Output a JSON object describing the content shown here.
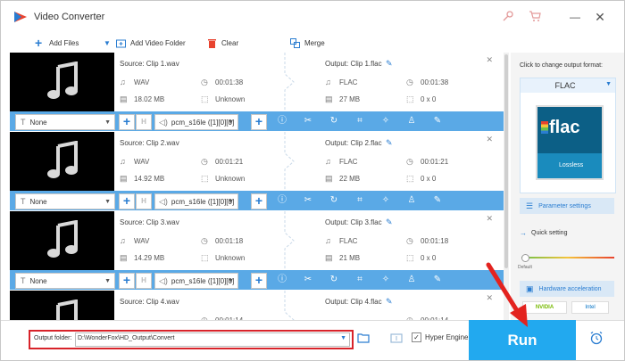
{
  "window": {
    "title": "Video Converter",
    "brand_color": "#2a7dd1",
    "accent_color": "#22a9ef",
    "icons": [
      "key-icon",
      "cart-icon",
      "minimize-icon",
      "close-icon"
    ]
  },
  "toolbar": {
    "add_files": "Add Files",
    "add_video_folder": "Add Video Folder",
    "clear": "Clear",
    "merge": "Merge"
  },
  "clips": [
    {
      "source": "Source: Clip 1.wav",
      "src_format": "WAV",
      "src_duration": "00:01:38",
      "src_size": "18.02 MB",
      "src_res": "Unknown",
      "output": "Output: Clip 1.flac",
      "out_format": "FLAC",
      "out_duration": "00:01:38",
      "out_size": "27 MB",
      "out_res": "0 x 0",
      "subtitle": "None",
      "audio": "pcm_s16le ([1][0][0]"
    },
    {
      "source": "Source: Clip 2.wav",
      "src_format": "WAV",
      "src_duration": "00:01:21",
      "src_size": "14.92 MB",
      "src_res": "Unknown",
      "output": "Output: Clip 2.flac",
      "out_format": "FLAC",
      "out_duration": "00:01:21",
      "out_size": "22 MB",
      "out_res": "0 x 0",
      "subtitle": "None",
      "audio": "pcm_s16le ([1][0][0]"
    },
    {
      "source": "Source: Clip 3.wav",
      "src_format": "WAV",
      "src_duration": "00:01:18",
      "src_size": "14.29 MB",
      "src_res": "Unknown",
      "output": "Output: Clip 3.flac",
      "out_format": "FLAC",
      "out_duration": "00:01:18",
      "out_size": "21 MB",
      "out_res": "0 x 0",
      "subtitle": "None",
      "audio": "pcm_s16le ([1][0][0]"
    },
    {
      "source": "Source: Clip 4.wav",
      "src_duration": "00:01:14",
      "output": "Output: Clip 4.flac",
      "out_duration": "00:01:14"
    }
  ],
  "right_panel": {
    "hint": "Click to change output format:",
    "format": "FLAC",
    "format_icon_text": "flac",
    "format_icon_sub": "Lossless",
    "parameter_settings": "Parameter settings",
    "quick_setting": "Quick setting",
    "default_label": "Default",
    "quality_level": 0,
    "hardware_acceleration": "Hardware acceleration",
    "nvidia": "NVIDIA",
    "intel": "Intel"
  },
  "bottom": {
    "output_folder_label": "Output folder:",
    "output_folder_path": "D:\\WonderFox\\HD_Output\\Convert",
    "hyper_engine": "Hyper Engine",
    "hyper_engine_checked": true,
    "run": "Run"
  }
}
